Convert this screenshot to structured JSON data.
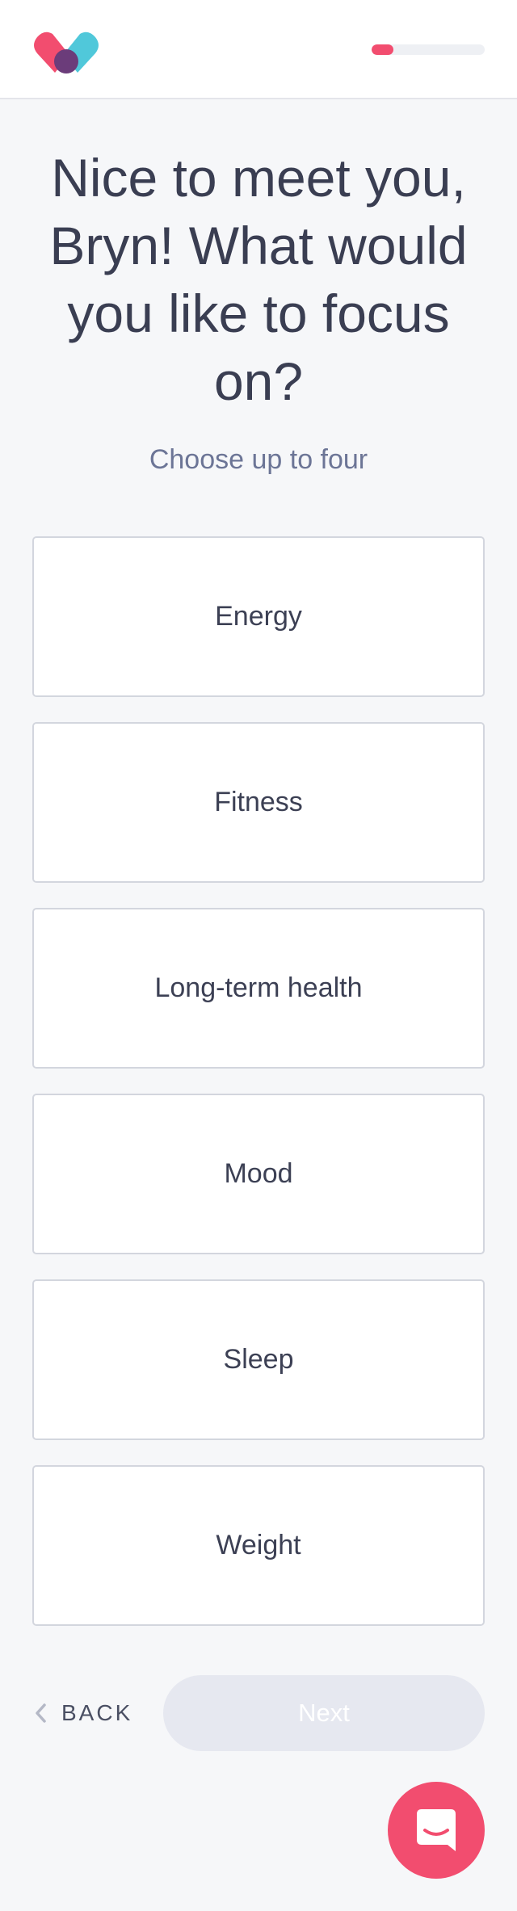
{
  "header": {
    "logo_icon": "heart-logo-icon",
    "progress_fraction": 0.19,
    "progress_color": "#f24d6f"
  },
  "main": {
    "title": "Nice to meet you, Bryn! What would you like to focus on?",
    "subtitle": "Choose up to four",
    "options": [
      {
        "label": "Energy"
      },
      {
        "label": "Fitness"
      },
      {
        "label": "Long-term health"
      },
      {
        "label": "Mood"
      },
      {
        "label": "Sleep"
      },
      {
        "label": "Weight"
      }
    ]
  },
  "footer": {
    "back_icon": "chevron-left-icon",
    "back_label": "BACK",
    "next_label": "Next"
  },
  "chat": {
    "icon": "chat-bubble-icon",
    "color": "#f24d6f"
  }
}
